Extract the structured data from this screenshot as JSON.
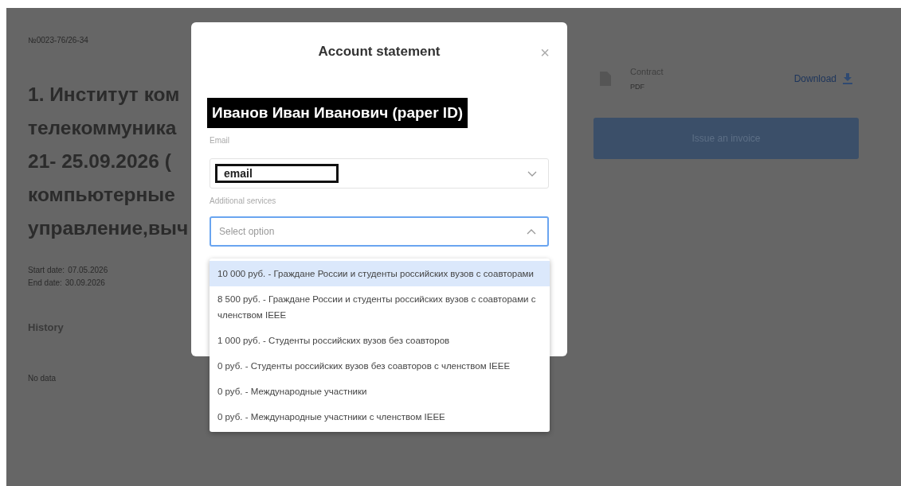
{
  "page": {
    "number": "№0023-76/26-34",
    "title_lines": [
      "1. Институт ком",
      "телекоммуника",
      "21- 25.09.2026 (",
      "компьютерные",
      "управление,выч"
    ],
    "start_date_label": "Start date:",
    "start_date": "07.05.2026",
    "end_date_label": "End date:",
    "end_date": "30.09.2026",
    "history_title": "History",
    "history_empty": "No data"
  },
  "contract": {
    "name": "Contract",
    "format": "PDF",
    "download": "Download"
  },
  "invoice_button": "Issue an invoice",
  "modal": {
    "title": "Account statement",
    "close": "×",
    "author": "Иванов Иван Иванович (paper ID)",
    "email_label": "Email",
    "email_value": "email",
    "services_label": "Additional services",
    "services_placeholder": "Select option",
    "services_expanded": true,
    "options": [
      {
        "label": "10 000 руб. - Граждане России и студенты российских вузов с соавторами",
        "highlighted": true
      },
      {
        "label": "8 500 руб. - Граждане России и студенты российских вузов с соавторами с членством IEEE",
        "highlighted": false
      },
      {
        "label": "1 000 руб. - Студенты российских вузов без соавторов",
        "highlighted": false
      },
      {
        "label": "0 руб. - Студенты российских вузов без соавторов с членством IEEE",
        "highlighted": false
      },
      {
        "label": "0 руб. - Международные участники",
        "highlighted": false
      },
      {
        "label": "0 руб. - Международные участники с членством IEEE",
        "highlighted": false
      }
    ]
  }
}
